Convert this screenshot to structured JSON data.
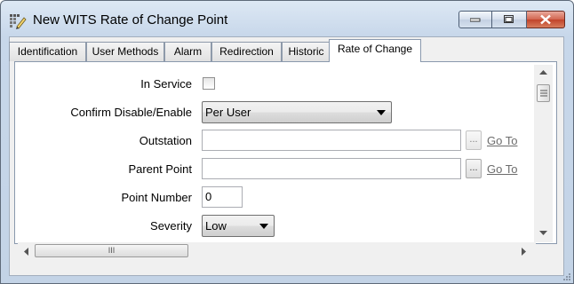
{
  "window": {
    "title": "New WITS Rate of Change Point",
    "controls": {
      "minimize_icon": "minimize-icon",
      "maximize_icon": "maximize-icon",
      "close_icon": "close-icon"
    }
  },
  "tabs": [
    {
      "label": "Identification",
      "active": false
    },
    {
      "label": "User Methods",
      "active": false
    },
    {
      "label": "Alarm",
      "active": false
    },
    {
      "label": "Redirection",
      "active": false
    },
    {
      "label": "Historic",
      "active": false
    },
    {
      "label": "Rate of Change",
      "active": true
    }
  ],
  "form": {
    "in_service": {
      "label": "In Service",
      "checked": false
    },
    "confirm_disable_enable": {
      "label": "Confirm Disable/Enable",
      "value": "Per User"
    },
    "outstation": {
      "label": "Outstation",
      "value": "",
      "browse": "...",
      "goto": "Go To"
    },
    "parent_point": {
      "label": "Parent Point",
      "value": "",
      "browse": "...",
      "goto": "Go To"
    },
    "point_number": {
      "label": "Point Number",
      "value": "0"
    },
    "severity": {
      "label": "Severity",
      "value": "Low"
    }
  },
  "scrollbar": {
    "h_thumb_grip": "III"
  },
  "colors": {
    "title_bg": "#c7d7ea",
    "close_button": "#c1432a",
    "link_disabled": "#6d6d6d"
  }
}
